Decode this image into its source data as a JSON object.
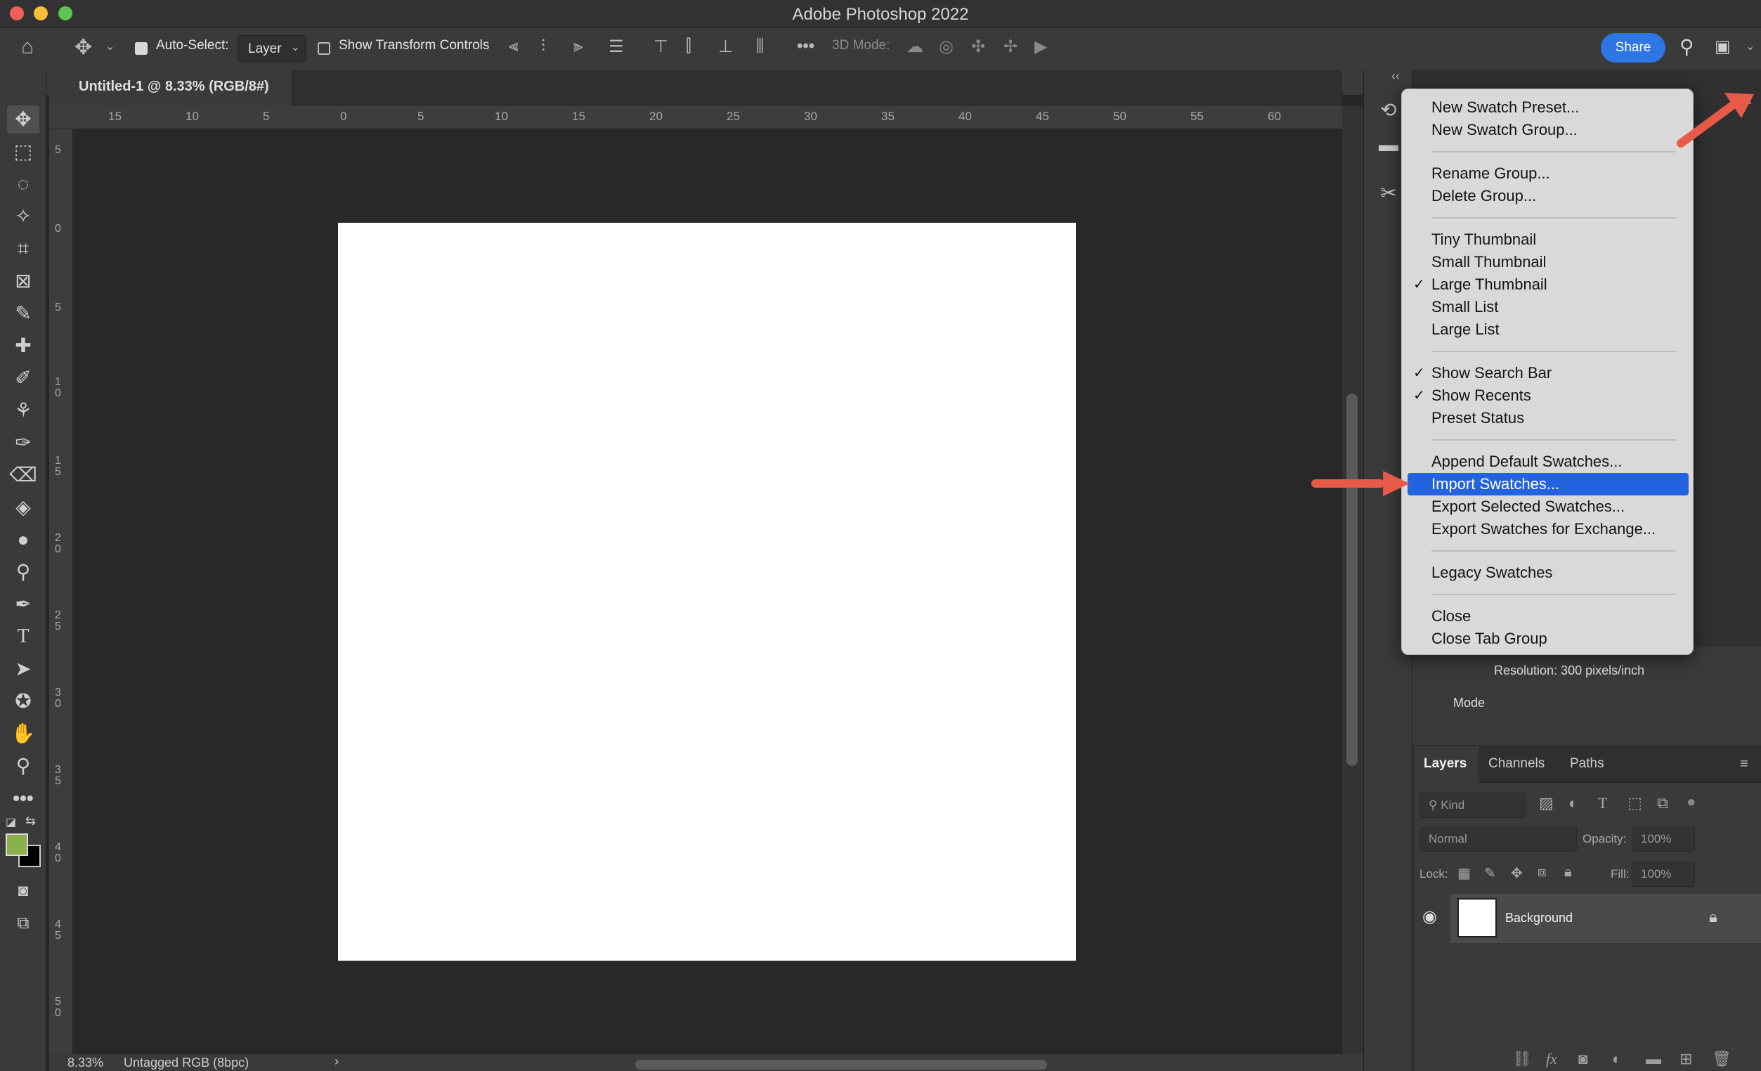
{
  "window": {
    "title": "Adobe Photoshop 2022"
  },
  "options_bar": {
    "auto_select_label": "Auto-Select:",
    "auto_select_value": "Layer",
    "show_transform_label": "Show Transform Controls",
    "mode_3d_label": "3D Mode:",
    "share_label": "Share"
  },
  "document_tab": {
    "label": "Untitled-1 @ 8.33% (RGB/8#)"
  },
  "ruler": {
    "top_ticks": [
      "15",
      "10",
      "5",
      "0",
      "5",
      "10",
      "15",
      "20",
      "25",
      "30",
      "35",
      "40",
      "45",
      "50",
      "55",
      "60"
    ],
    "left_ticks": [
      "5",
      "0",
      "5",
      "1\n0",
      "1\n5",
      "2\n0",
      "2\n5",
      "3\n0",
      "3\n5",
      "4\n0",
      "4\n5",
      "5\n0"
    ]
  },
  "status_bar": {
    "zoom": "8.33%",
    "profile": "Untagged RGB (8bpc)",
    "more": "›"
  },
  "properties": {
    "resolution": "Resolution: 300 pixels/inch",
    "mode_label": "Mode"
  },
  "layers_panel": {
    "tabs": [
      "Layers",
      "Channels",
      "Paths"
    ],
    "filter_label": "Kind",
    "blend_mode": "Normal",
    "opacity_label": "Opacity:",
    "opacity_value": "100%",
    "lock_label": "Lock:",
    "fill_label": "Fill:",
    "fill_value": "100%",
    "layers": [
      {
        "name": "Background",
        "visible": true,
        "locked": true
      }
    ]
  },
  "flyout_menu": {
    "items": [
      {
        "label": "New Swatch Preset...",
        "checked": false
      },
      {
        "label": "New Swatch Group...",
        "checked": false
      },
      {
        "label": "Rename Group...",
        "checked": false
      },
      {
        "label": "Delete Group...",
        "checked": false
      },
      {
        "label": "Tiny Thumbnail",
        "checked": false
      },
      {
        "label": "Small Thumbnail",
        "checked": false
      },
      {
        "label": "Large Thumbnail",
        "checked": true
      },
      {
        "label": "Small List",
        "checked": false
      },
      {
        "label": "Large List",
        "checked": false
      },
      {
        "label": "Show Search Bar",
        "checked": true
      },
      {
        "label": "Show Recents",
        "checked": true
      },
      {
        "label": "Preset Status",
        "checked": false
      },
      {
        "label": "Append Default Swatches...",
        "checked": false
      },
      {
        "label": "Import Swatches...",
        "checked": false,
        "highlighted": true
      },
      {
        "label": "Export Selected Swatches...",
        "checked": false
      },
      {
        "label": "Export Swatches for Exchange...",
        "checked": false
      },
      {
        "label": "Legacy Swatches",
        "checked": false
      },
      {
        "label": "Close",
        "checked": false
      },
      {
        "label": "Close Tab Group",
        "checked": false
      }
    ]
  },
  "colors": {
    "accent": "#2e76e4",
    "menu_highlight": "#2463e0",
    "annotation_arrow": "#e75a48",
    "foreground_swatch": "#8ab04a",
    "background_swatch": "#000000"
  },
  "icons": {
    "checkmark": "✓",
    "eye": "visibility-eye-icon",
    "lock": "lock-icon"
  }
}
